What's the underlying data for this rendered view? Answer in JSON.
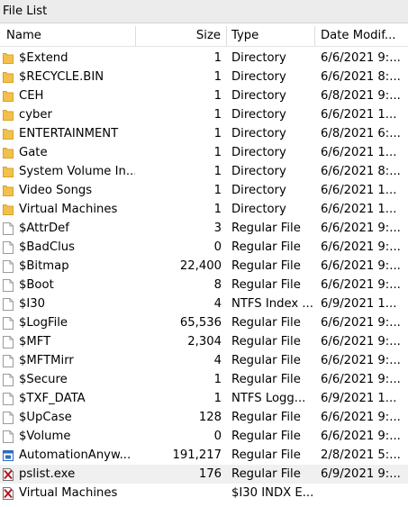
{
  "panel": {
    "title": "File List"
  },
  "columns": {
    "name": "Name",
    "size": "Size",
    "type": "Type",
    "date": "Date Modif..."
  },
  "rows": [
    {
      "icon": "folder-icon",
      "name": "$Extend",
      "size": "1",
      "type": "Directory",
      "date": "6/6/2021 9:..."
    },
    {
      "icon": "folder-icon",
      "name": "$RECYCLE.BIN",
      "size": "1",
      "type": "Directory",
      "date": "6/6/2021 8:..."
    },
    {
      "icon": "folder-icon",
      "name": "CEH",
      "size": "1",
      "type": "Directory",
      "date": "6/8/2021 9:..."
    },
    {
      "icon": "folder-icon",
      "name": "cyber",
      "size": "1",
      "type": "Directory",
      "date": "6/6/2021 1..."
    },
    {
      "icon": "folder-icon",
      "name": "ENTERTAINMENT",
      "size": "1",
      "type": "Directory",
      "date": "6/8/2021 6:..."
    },
    {
      "icon": "folder-icon",
      "name": "Gate",
      "size": "1",
      "type": "Directory",
      "date": "6/6/2021 1..."
    },
    {
      "icon": "folder-icon",
      "name": "System Volume In...",
      "size": "1",
      "type": "Directory",
      "date": "6/6/2021 8:..."
    },
    {
      "icon": "folder-icon",
      "name": "Video Songs",
      "size": "1",
      "type": "Directory",
      "date": "6/6/2021 1..."
    },
    {
      "icon": "folder-icon",
      "name": "Virtual Machines",
      "size": "1",
      "type": "Directory",
      "date": "6/6/2021 1..."
    },
    {
      "icon": "file-icon",
      "name": "$AttrDef",
      "size": "3",
      "type": "Regular File",
      "date": "6/6/2021 9:..."
    },
    {
      "icon": "file-icon",
      "name": "$BadClus",
      "size": "0",
      "type": "Regular File",
      "date": "6/6/2021 9:..."
    },
    {
      "icon": "file-icon",
      "name": "$Bitmap",
      "size": "22,400",
      "type": "Regular File",
      "date": "6/6/2021 9:..."
    },
    {
      "icon": "file-icon",
      "name": "$Boot",
      "size": "8",
      "type": "Regular File",
      "date": "6/6/2021 9:..."
    },
    {
      "icon": "file-icon",
      "name": "$I30",
      "size": "4",
      "type": "NTFS Index ...",
      "date": "6/9/2021 1..."
    },
    {
      "icon": "file-icon",
      "name": "$LogFile",
      "size": "65,536",
      "type": "Regular File",
      "date": "6/6/2021 9:..."
    },
    {
      "icon": "file-icon",
      "name": "$MFT",
      "size": "2,304",
      "type": "Regular File",
      "date": "6/6/2021 9:..."
    },
    {
      "icon": "file-icon",
      "name": "$MFTMirr",
      "size": "4",
      "type": "Regular File",
      "date": "6/6/2021 9:..."
    },
    {
      "icon": "file-icon",
      "name": "$Secure",
      "size": "1",
      "type": "Regular File",
      "date": "6/6/2021 9:..."
    },
    {
      "icon": "file-icon",
      "name": "$TXF_DATA",
      "size": "1",
      "type": "NTFS Logg...",
      "date": "6/9/2021 1..."
    },
    {
      "icon": "file-icon",
      "name": "$UpCase",
      "size": "128",
      "type": "Regular File",
      "date": "6/6/2021 9:..."
    },
    {
      "icon": "file-icon",
      "name": "$Volume",
      "size": "0",
      "type": "Regular File",
      "date": "6/6/2021 9:..."
    },
    {
      "icon": "app-window-icon",
      "name": "AutomationAnyw...",
      "size": "191,217",
      "type": "Regular File",
      "date": "2/8/2021 5:..."
    },
    {
      "icon": "deleted-file-icon",
      "name": "pslist.exe",
      "size": "176",
      "type": "Regular File",
      "date": "6/9/2021 9:...",
      "selected": true
    },
    {
      "icon": "deleted-file-icon",
      "name": "Virtual Machines",
      "size": "",
      "type": "$I30 INDX E...",
      "date": ""
    }
  ],
  "colors": {
    "folder": "#f1c14b",
    "folder_dark": "#d9a22b",
    "file_outline": "#9a9a9a",
    "deleted_mark": "#b0151e",
    "app_blue": "#2b6cc4"
  }
}
